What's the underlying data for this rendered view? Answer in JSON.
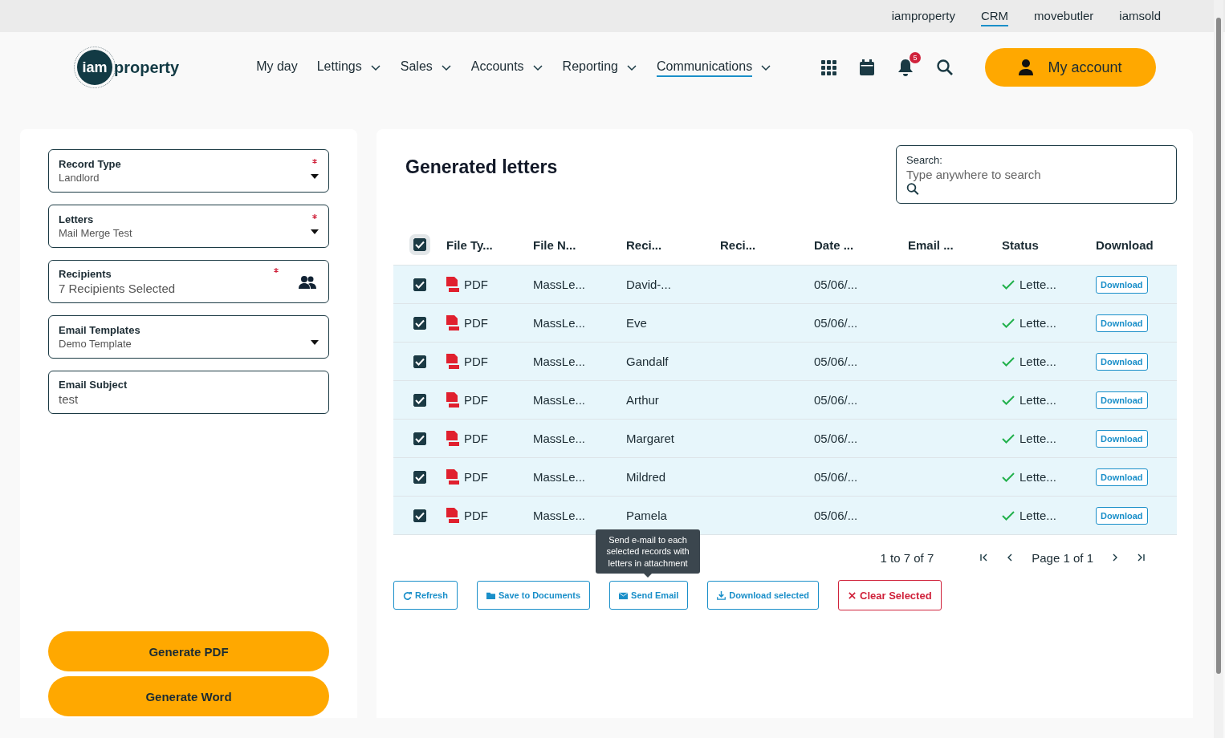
{
  "top_links": [
    {
      "label": "iamproperty",
      "selected": false
    },
    {
      "label": "CRM",
      "selected": true
    },
    {
      "label": "movebutler",
      "selected": false
    },
    {
      "label": "iamsold",
      "selected": false
    }
  ],
  "logo": {
    "part_1": "iam",
    "part_2": "property"
  },
  "nav": [
    {
      "label": "My day",
      "dropdown": false,
      "selected": false
    },
    {
      "label": "Lettings",
      "dropdown": true,
      "selected": false
    },
    {
      "label": "Sales",
      "dropdown": true,
      "selected": false
    },
    {
      "label": "Accounts",
      "dropdown": true,
      "selected": false
    },
    {
      "label": "Reporting",
      "dropdown": true,
      "selected": false
    },
    {
      "label": "Communications",
      "dropdown": true,
      "selected": true
    }
  ],
  "notification_count": "5",
  "account_button": "My account",
  "form": [
    {
      "label": "Record Type",
      "value": "Landlord",
      "required": true,
      "kind": "dropdown"
    },
    {
      "label": "Letters",
      "value": "Mail Merge Test",
      "required": true,
      "kind": "dropdown"
    },
    {
      "label": "Recipients",
      "value": "7 Recipients Selected",
      "required": true,
      "kind": "people"
    },
    {
      "label": "Email Templates",
      "value": "Demo Template",
      "required": false,
      "kind": "dropdown"
    },
    {
      "label": "Email Subject",
      "value": "test",
      "required": false,
      "kind": "text"
    }
  ],
  "generate_buttons": [
    "Generate PDF",
    "Generate Word"
  ],
  "title": "Generated letters",
  "search": {
    "label": "Search:",
    "placeholder": "Type anywhere to search"
  },
  "table": {
    "all_checked": true,
    "columns": [
      "File Ty...",
      "File N...",
      "Reci...",
      "Reci...",
      "Date ...",
      "Email ...",
      "Status",
      "Download"
    ],
    "rows": [
      {
        "checked": true,
        "file_type": "PDF",
        "file_name": "MassLe...",
        "recipient": "David-...",
        "date": "05/06/...",
        "status": "Lette...",
        "download": "Download"
      },
      {
        "checked": true,
        "file_type": "PDF",
        "file_name": "MassLe...",
        "recipient": "Eve",
        "date": "05/06/...",
        "status": "Lette...",
        "download": "Download"
      },
      {
        "checked": true,
        "file_type": "PDF",
        "file_name": "MassLe...",
        "recipient": "Gandalf",
        "date": "05/06/...",
        "status": "Lette...",
        "download": "Download"
      },
      {
        "checked": true,
        "file_type": "PDF",
        "file_name": "MassLe...",
        "recipient": "Arthur",
        "date": "05/06/...",
        "status": "Lette...",
        "download": "Download"
      },
      {
        "checked": true,
        "file_type": "PDF",
        "file_name": "MassLe...",
        "recipient": "Margaret",
        "date": "05/06/...",
        "status": "Lette...",
        "download": "Download"
      },
      {
        "checked": true,
        "file_type": "PDF",
        "file_name": "MassLe...",
        "recipient": "Mildred",
        "date": "05/06/...",
        "status": "Lette...",
        "download": "Download"
      },
      {
        "checked": true,
        "file_type": "PDF",
        "file_name": "MassLe...",
        "recipient": "Pamela",
        "date": "05/06/...",
        "status": "Lette...",
        "download": "Download"
      }
    ]
  },
  "pager": {
    "summary": "1 to 7 of 7",
    "page": "Page 1 of 1"
  },
  "actions": [
    {
      "label": "Refresh",
      "kind": "refresh"
    },
    {
      "label": "Save to Documents",
      "kind": "folder"
    },
    {
      "label": "Send Email",
      "kind": "email"
    },
    {
      "label": "Download selected",
      "kind": "download"
    },
    {
      "label": "Clear Selected",
      "kind": "clear"
    }
  ],
  "tooltip": "Send e-mail to each selected records with letters in attachment"
}
